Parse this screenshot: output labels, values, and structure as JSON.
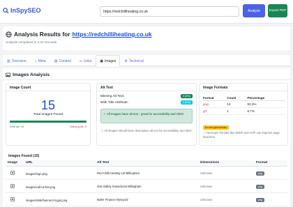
{
  "topbar": {
    "logo_text": "InSpySEO",
    "url_value": "https://redchilliheating.co.uk",
    "analyze_label": "Analyze",
    "export_label": "Export PDF"
  },
  "header": {
    "title_prefix": "Analysis Results for",
    "title_link": "https://redchilliheating.co.uk",
    "subtitle": "Analysis completed in 2.22 seconds"
  },
  "tabs": [
    {
      "label": "Overview",
      "icon": "chart-icon"
    },
    {
      "label": "Meta",
      "icon": "tag-icon"
    },
    {
      "label": "Content",
      "icon": "document-icon"
    },
    {
      "label": "Links",
      "icon": "link-icon"
    },
    {
      "label": "Images",
      "icon": "image-icon",
      "active": true
    },
    {
      "label": "Technical",
      "icon": "gear-icon"
    }
  ],
  "section": {
    "title": "Images Analysis"
  },
  "image_count": {
    "heading": "Image Count",
    "total": "15",
    "label": "Total Images Found",
    "with_alt": "With Alt: 15",
    "missing_alt": "Missing Alt: 0",
    "with_alt_fraction": 1.0
  },
  "alt_text": {
    "heading": "Alt Text",
    "missing_label": "Missing Alt Text:",
    "missing_badge": "0 (0%)",
    "title_label": "With Title Attribute:",
    "title_badge": "0 (0%)",
    "alert": "All images have alt text - great for accessibility and SEO!",
    "note": "All images should have descriptive alt text for accessibility and SEO."
  },
  "image_formats": {
    "heading": "Image Formats",
    "columns": [
      "Format",
      "Count",
      "Percentage"
    ],
    "rows": [
      {
        "format": "png",
        "count": "14",
        "percentage": "93.3%"
      },
      {
        "format": "gif",
        "count": "1",
        "percentage": "6.7%"
      }
    ],
    "tip_badge": "No next-gen formats",
    "note": "Next-gen formats like WebP and AVIF can improve page load time."
  },
  "images_found": {
    "title": "Images Found (15)",
    "columns": [
      "Image",
      "URL",
      "Alt Text",
      "Dimensions",
      "Format"
    ],
    "rows": [
      {
        "url": "images/logo.png",
        "alt": "Red Chilli Heating Ltd Billingham",
        "dimensions": "Unknown",
        "format": "png"
      },
      {
        "url": "images/call-us-btn.png",
        "alt": "Gas Safety Inspections Billingham",
        "dimensions": "Unknown",
        "format": "png"
      },
      {
        "url": "images/slide/banner2-logos.png",
        "alt": "Boiler Finance Wynyard",
        "dimensions": "Unknown",
        "format": "png"
      }
    ]
  },
  "colors": {
    "brand": "#3558e8",
    "success": "#198754",
    "danger": "#dc3545",
    "info": "#0dcaf0",
    "warning": "#ffc107"
  }
}
